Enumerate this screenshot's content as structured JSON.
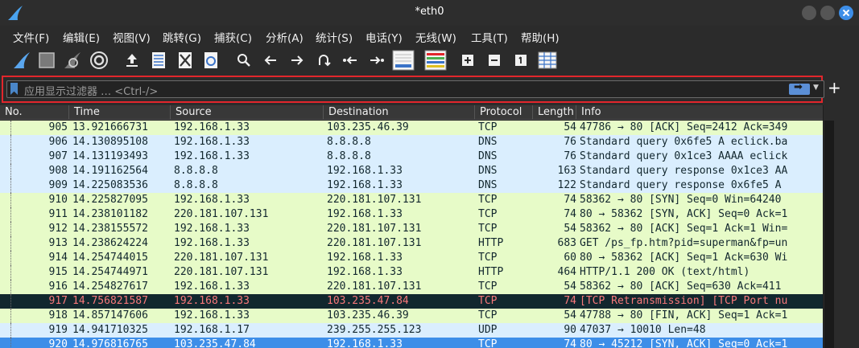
{
  "window": {
    "title": "*eth0"
  },
  "menu": [
    {
      "label": "文件(F)"
    },
    {
      "label": "编辑(E)"
    },
    {
      "label": "视图(V)"
    },
    {
      "label": "跳转(G)"
    },
    {
      "label": "捕获(C)"
    },
    {
      "label": "分析(A)"
    },
    {
      "label": "统计(S)"
    },
    {
      "label": "电话(Y)"
    },
    {
      "label": "无线(W)"
    },
    {
      "label": "工具(T)"
    },
    {
      "label": "帮助(H)"
    }
  ],
  "toolbar": {
    "icons": [
      "start-capture-icon",
      "stop-capture-icon",
      "restart-capture-icon",
      "capture-options-icon",
      "open-file-icon",
      "save-file-icon",
      "close-file-icon",
      "reload-file-icon",
      "find-packet-icon",
      "go-back-icon",
      "go-forward-icon",
      "go-to-packet-icon",
      "first-packet-icon",
      "last-packet-icon",
      "auto-scroll-icon",
      "colorize-icon",
      "zoom-in-icon",
      "zoom-out-icon",
      "normal-size-icon",
      "resize-columns-icon"
    ]
  },
  "filter": {
    "placeholder": "应用显示过滤器 … <Ctrl-/>",
    "value": ""
  },
  "columns": [
    "No.",
    "Time",
    "Source",
    "Destination",
    "Protocol",
    "Length",
    "Info"
  ],
  "colors": {
    "tcp": "#e7fbc8",
    "dns_udp": "#daeefe",
    "bad": "#12272e",
    "bad_fg": "#f7787a",
    "selected": "#3d8ee8",
    "filter_border": "#e2262c"
  },
  "packets": [
    {
      "no": "905",
      "time": "13.921666731",
      "src": "192.168.1.33",
      "dst": "103.235.46.39",
      "proto": "TCP",
      "len": "54",
      "info": "47786 → 80 [ACK] Seq=2412 Ack=349",
      "style": "tcp"
    },
    {
      "no": "906",
      "time": "14.130895108",
      "src": "192.168.1.33",
      "dst": "8.8.8.8",
      "proto": "DNS",
      "len": "76",
      "info": "Standard query 0x6fe5 A eclick.ba",
      "style": "dns_udp"
    },
    {
      "no": "907",
      "time": "14.131193493",
      "src": "192.168.1.33",
      "dst": "8.8.8.8",
      "proto": "DNS",
      "len": "76",
      "info": "Standard query 0x1ce3 AAAA eclick",
      "style": "dns_udp"
    },
    {
      "no": "908",
      "time": "14.191162564",
      "src": "8.8.8.8",
      "dst": "192.168.1.33",
      "proto": "DNS",
      "len": "163",
      "info": "Standard query response 0x1ce3 AA",
      "style": "dns_udp"
    },
    {
      "no": "909",
      "time": "14.225083536",
      "src": "8.8.8.8",
      "dst": "192.168.1.33",
      "proto": "DNS",
      "len": "122",
      "info": "Standard query response 0x6fe5 A",
      "style": "dns_udp"
    },
    {
      "no": "910",
      "time": "14.225827095",
      "src": "192.168.1.33",
      "dst": "220.181.107.131",
      "proto": "TCP",
      "len": "74",
      "info": "58362 → 80 [SYN] Seq=0 Win=64240",
      "style": "tcp"
    },
    {
      "no": "911",
      "time": "14.238101182",
      "src": "220.181.107.131",
      "dst": "192.168.1.33",
      "proto": "TCP",
      "len": "74",
      "info": "80 → 58362 [SYN, ACK] Seq=0 Ack=1",
      "style": "tcp"
    },
    {
      "no": "912",
      "time": "14.238155572",
      "src": "192.168.1.33",
      "dst": "220.181.107.131",
      "proto": "TCP",
      "len": "54",
      "info": "58362 → 80 [ACK] Seq=1 Ack=1 Win=",
      "style": "tcp"
    },
    {
      "no": "913",
      "time": "14.238624224",
      "src": "192.168.1.33",
      "dst": "220.181.107.131",
      "proto": "HTTP",
      "len": "683",
      "info": "GET /ps_fp.htm?pid=superman&fp=un",
      "style": "tcp"
    },
    {
      "no": "914",
      "time": "14.254744015",
      "src": "220.181.107.131",
      "dst": "192.168.1.33",
      "proto": "TCP",
      "len": "60",
      "info": "80 → 58362 [ACK] Seq=1 Ack=630 Wi",
      "style": "tcp"
    },
    {
      "no": "915",
      "time": "14.254744971",
      "src": "220.181.107.131",
      "dst": "192.168.1.33",
      "proto": "HTTP",
      "len": "464",
      "info": "HTTP/1.1 200 OK  (text/html)",
      "style": "tcp"
    },
    {
      "no": "916",
      "time": "14.254827617",
      "src": "192.168.1.33",
      "dst": "220.181.107.131",
      "proto": "TCP",
      "len": "54",
      "info": "58362 → 80 [ACK] Seq=630 Ack=411",
      "style": "tcp"
    },
    {
      "no": "917",
      "time": "14.756821587",
      "src": "192.168.1.33",
      "dst": "103.235.47.84",
      "proto": "TCP",
      "len": "74",
      "info": "[TCP Retransmission] [TCP Port nu",
      "style": "bad"
    },
    {
      "no": "918",
      "time": "14.857147606",
      "src": "192.168.1.33",
      "dst": "103.235.46.39",
      "proto": "TCP",
      "len": "54",
      "info": "47788 → 80 [FIN, ACK] Seq=1 Ack=1",
      "style": "tcp"
    },
    {
      "no": "919",
      "time": "14.941710325",
      "src": "192.168.1.17",
      "dst": "239.255.255.123",
      "proto": "UDP",
      "len": "90",
      "info": "47037 → 10010 Len=48",
      "style": "dns_udp"
    },
    {
      "no": "920",
      "time": "14.976816765",
      "src": "103.235.47.84",
      "dst": "192.168.1.33",
      "proto": "TCP",
      "len": "74",
      "info": "80 → 45212 [SYN, ACK] Seq=0 Ack=1",
      "style": "selected"
    }
  ]
}
